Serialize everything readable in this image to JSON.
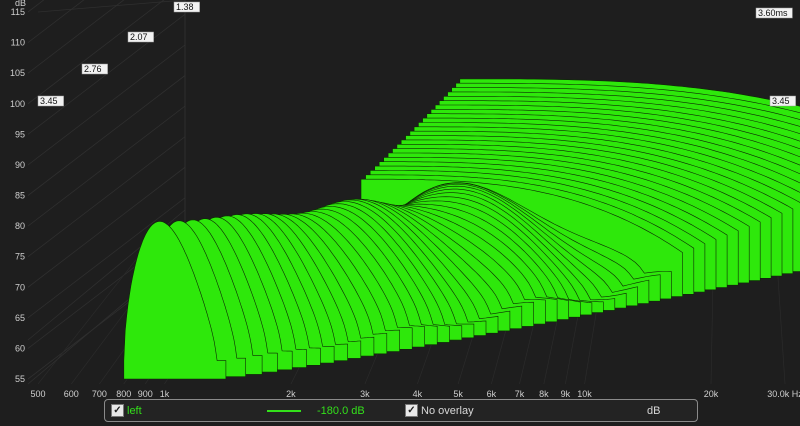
{
  "chart_data": {
    "type": "area",
    "subtype": "waterfall",
    "y_unit": "dB",
    "y_ticks": [
      115,
      110,
      105,
      100,
      95,
      90,
      85,
      80,
      75,
      70,
      65,
      60,
      55
    ],
    "x_ticks": [
      "500",
      "600",
      "700",
      "800",
      "900",
      "1k",
      "2k",
      "3k",
      "4k",
      "5k",
      "6k",
      "7k",
      "8k",
      "9k",
      "10k",
      "20k"
    ],
    "x_last_tick": "30.0k Hz",
    "xlim_hz": [
      500,
      30000
    ],
    "ylim_db": [
      55,
      115
    ],
    "time_labels": [
      "3.45",
      "2.76",
      "2.07",
      "1.38",
      "3.60ms",
      "3.45"
    ],
    "slice_count": 60,
    "fill_color": "#2ee80b",
    "edge_color": "#0d2a04",
    "grid": true
  },
  "legend": {
    "left_checked": true,
    "left_label": "left",
    "level_label": "-180.0 dB",
    "overlay_checked": true,
    "overlay_label": "No overlay",
    "unit_label": "dB",
    "left_color": "#33e01a"
  },
  "icons": {
    "checkbox": "checkmark-icon"
  }
}
